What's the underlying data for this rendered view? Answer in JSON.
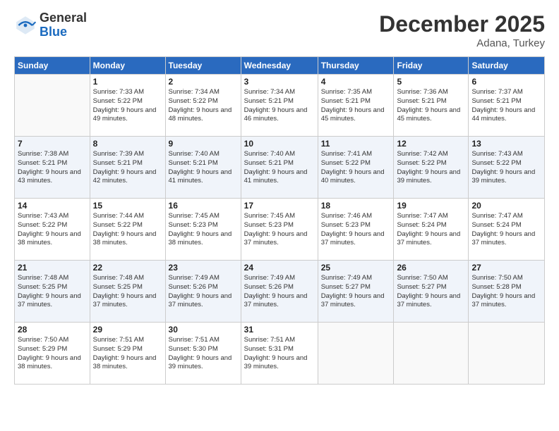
{
  "header": {
    "logo_general": "General",
    "logo_blue": "Blue",
    "month": "December 2025",
    "location": "Adana, Turkey"
  },
  "weekdays": [
    "Sunday",
    "Monday",
    "Tuesday",
    "Wednesday",
    "Thursday",
    "Friday",
    "Saturday"
  ],
  "weeks": [
    [
      {
        "day": "",
        "sunrise": "",
        "sunset": "",
        "daylight": ""
      },
      {
        "day": "1",
        "sunrise": "Sunrise: 7:33 AM",
        "sunset": "Sunset: 5:22 PM",
        "daylight": "Daylight: 9 hours and 49 minutes."
      },
      {
        "day": "2",
        "sunrise": "Sunrise: 7:34 AM",
        "sunset": "Sunset: 5:22 PM",
        "daylight": "Daylight: 9 hours and 48 minutes."
      },
      {
        "day": "3",
        "sunrise": "Sunrise: 7:34 AM",
        "sunset": "Sunset: 5:21 PM",
        "daylight": "Daylight: 9 hours and 46 minutes."
      },
      {
        "day": "4",
        "sunrise": "Sunrise: 7:35 AM",
        "sunset": "Sunset: 5:21 PM",
        "daylight": "Daylight: 9 hours and 45 minutes."
      },
      {
        "day": "5",
        "sunrise": "Sunrise: 7:36 AM",
        "sunset": "Sunset: 5:21 PM",
        "daylight": "Daylight: 9 hours and 45 minutes."
      },
      {
        "day": "6",
        "sunrise": "Sunrise: 7:37 AM",
        "sunset": "Sunset: 5:21 PM",
        "daylight": "Daylight: 9 hours and 44 minutes."
      }
    ],
    [
      {
        "day": "7",
        "sunrise": "Sunrise: 7:38 AM",
        "sunset": "Sunset: 5:21 PM",
        "daylight": "Daylight: 9 hours and 43 minutes."
      },
      {
        "day": "8",
        "sunrise": "Sunrise: 7:39 AM",
        "sunset": "Sunset: 5:21 PM",
        "daylight": "Daylight: 9 hours and 42 minutes."
      },
      {
        "day": "9",
        "sunrise": "Sunrise: 7:40 AM",
        "sunset": "Sunset: 5:21 PM",
        "daylight": "Daylight: 9 hours and 41 minutes."
      },
      {
        "day": "10",
        "sunrise": "Sunrise: 7:40 AM",
        "sunset": "Sunset: 5:21 PM",
        "daylight": "Daylight: 9 hours and 41 minutes."
      },
      {
        "day": "11",
        "sunrise": "Sunrise: 7:41 AM",
        "sunset": "Sunset: 5:22 PM",
        "daylight": "Daylight: 9 hours and 40 minutes."
      },
      {
        "day": "12",
        "sunrise": "Sunrise: 7:42 AM",
        "sunset": "Sunset: 5:22 PM",
        "daylight": "Daylight: 9 hours and 39 minutes."
      },
      {
        "day": "13",
        "sunrise": "Sunrise: 7:43 AM",
        "sunset": "Sunset: 5:22 PM",
        "daylight": "Daylight: 9 hours and 39 minutes."
      }
    ],
    [
      {
        "day": "14",
        "sunrise": "Sunrise: 7:43 AM",
        "sunset": "Sunset: 5:22 PM",
        "daylight": "Daylight: 9 hours and 38 minutes."
      },
      {
        "day": "15",
        "sunrise": "Sunrise: 7:44 AM",
        "sunset": "Sunset: 5:22 PM",
        "daylight": "Daylight: 9 hours and 38 minutes."
      },
      {
        "day": "16",
        "sunrise": "Sunrise: 7:45 AM",
        "sunset": "Sunset: 5:23 PM",
        "daylight": "Daylight: 9 hours and 38 minutes."
      },
      {
        "day": "17",
        "sunrise": "Sunrise: 7:45 AM",
        "sunset": "Sunset: 5:23 PM",
        "daylight": "Daylight: 9 hours and 37 minutes."
      },
      {
        "day": "18",
        "sunrise": "Sunrise: 7:46 AM",
        "sunset": "Sunset: 5:23 PM",
        "daylight": "Daylight: 9 hours and 37 minutes."
      },
      {
        "day": "19",
        "sunrise": "Sunrise: 7:47 AM",
        "sunset": "Sunset: 5:24 PM",
        "daylight": "Daylight: 9 hours and 37 minutes."
      },
      {
        "day": "20",
        "sunrise": "Sunrise: 7:47 AM",
        "sunset": "Sunset: 5:24 PM",
        "daylight": "Daylight: 9 hours and 37 minutes."
      }
    ],
    [
      {
        "day": "21",
        "sunrise": "Sunrise: 7:48 AM",
        "sunset": "Sunset: 5:25 PM",
        "daylight": "Daylight: 9 hours and 37 minutes."
      },
      {
        "day": "22",
        "sunrise": "Sunrise: 7:48 AM",
        "sunset": "Sunset: 5:25 PM",
        "daylight": "Daylight: 9 hours and 37 minutes."
      },
      {
        "day": "23",
        "sunrise": "Sunrise: 7:49 AM",
        "sunset": "Sunset: 5:26 PM",
        "daylight": "Daylight: 9 hours and 37 minutes."
      },
      {
        "day": "24",
        "sunrise": "Sunrise: 7:49 AM",
        "sunset": "Sunset: 5:26 PM",
        "daylight": "Daylight: 9 hours and 37 minutes."
      },
      {
        "day": "25",
        "sunrise": "Sunrise: 7:49 AM",
        "sunset": "Sunset: 5:27 PM",
        "daylight": "Daylight: 9 hours and 37 minutes."
      },
      {
        "day": "26",
        "sunrise": "Sunrise: 7:50 AM",
        "sunset": "Sunset: 5:27 PM",
        "daylight": "Daylight: 9 hours and 37 minutes."
      },
      {
        "day": "27",
        "sunrise": "Sunrise: 7:50 AM",
        "sunset": "Sunset: 5:28 PM",
        "daylight": "Daylight: 9 hours and 37 minutes."
      }
    ],
    [
      {
        "day": "28",
        "sunrise": "Sunrise: 7:50 AM",
        "sunset": "Sunset: 5:29 PM",
        "daylight": "Daylight: 9 hours and 38 minutes."
      },
      {
        "day": "29",
        "sunrise": "Sunrise: 7:51 AM",
        "sunset": "Sunset: 5:29 PM",
        "daylight": "Daylight: 9 hours and 38 minutes."
      },
      {
        "day": "30",
        "sunrise": "Sunrise: 7:51 AM",
        "sunset": "Sunset: 5:30 PM",
        "daylight": "Daylight: 9 hours and 39 minutes."
      },
      {
        "day": "31",
        "sunrise": "Sunrise: 7:51 AM",
        "sunset": "Sunset: 5:31 PM",
        "daylight": "Daylight: 9 hours and 39 minutes."
      },
      {
        "day": "",
        "sunrise": "",
        "sunset": "",
        "daylight": ""
      },
      {
        "day": "",
        "sunrise": "",
        "sunset": "",
        "daylight": ""
      },
      {
        "day": "",
        "sunrise": "",
        "sunset": "",
        "daylight": ""
      }
    ]
  ]
}
